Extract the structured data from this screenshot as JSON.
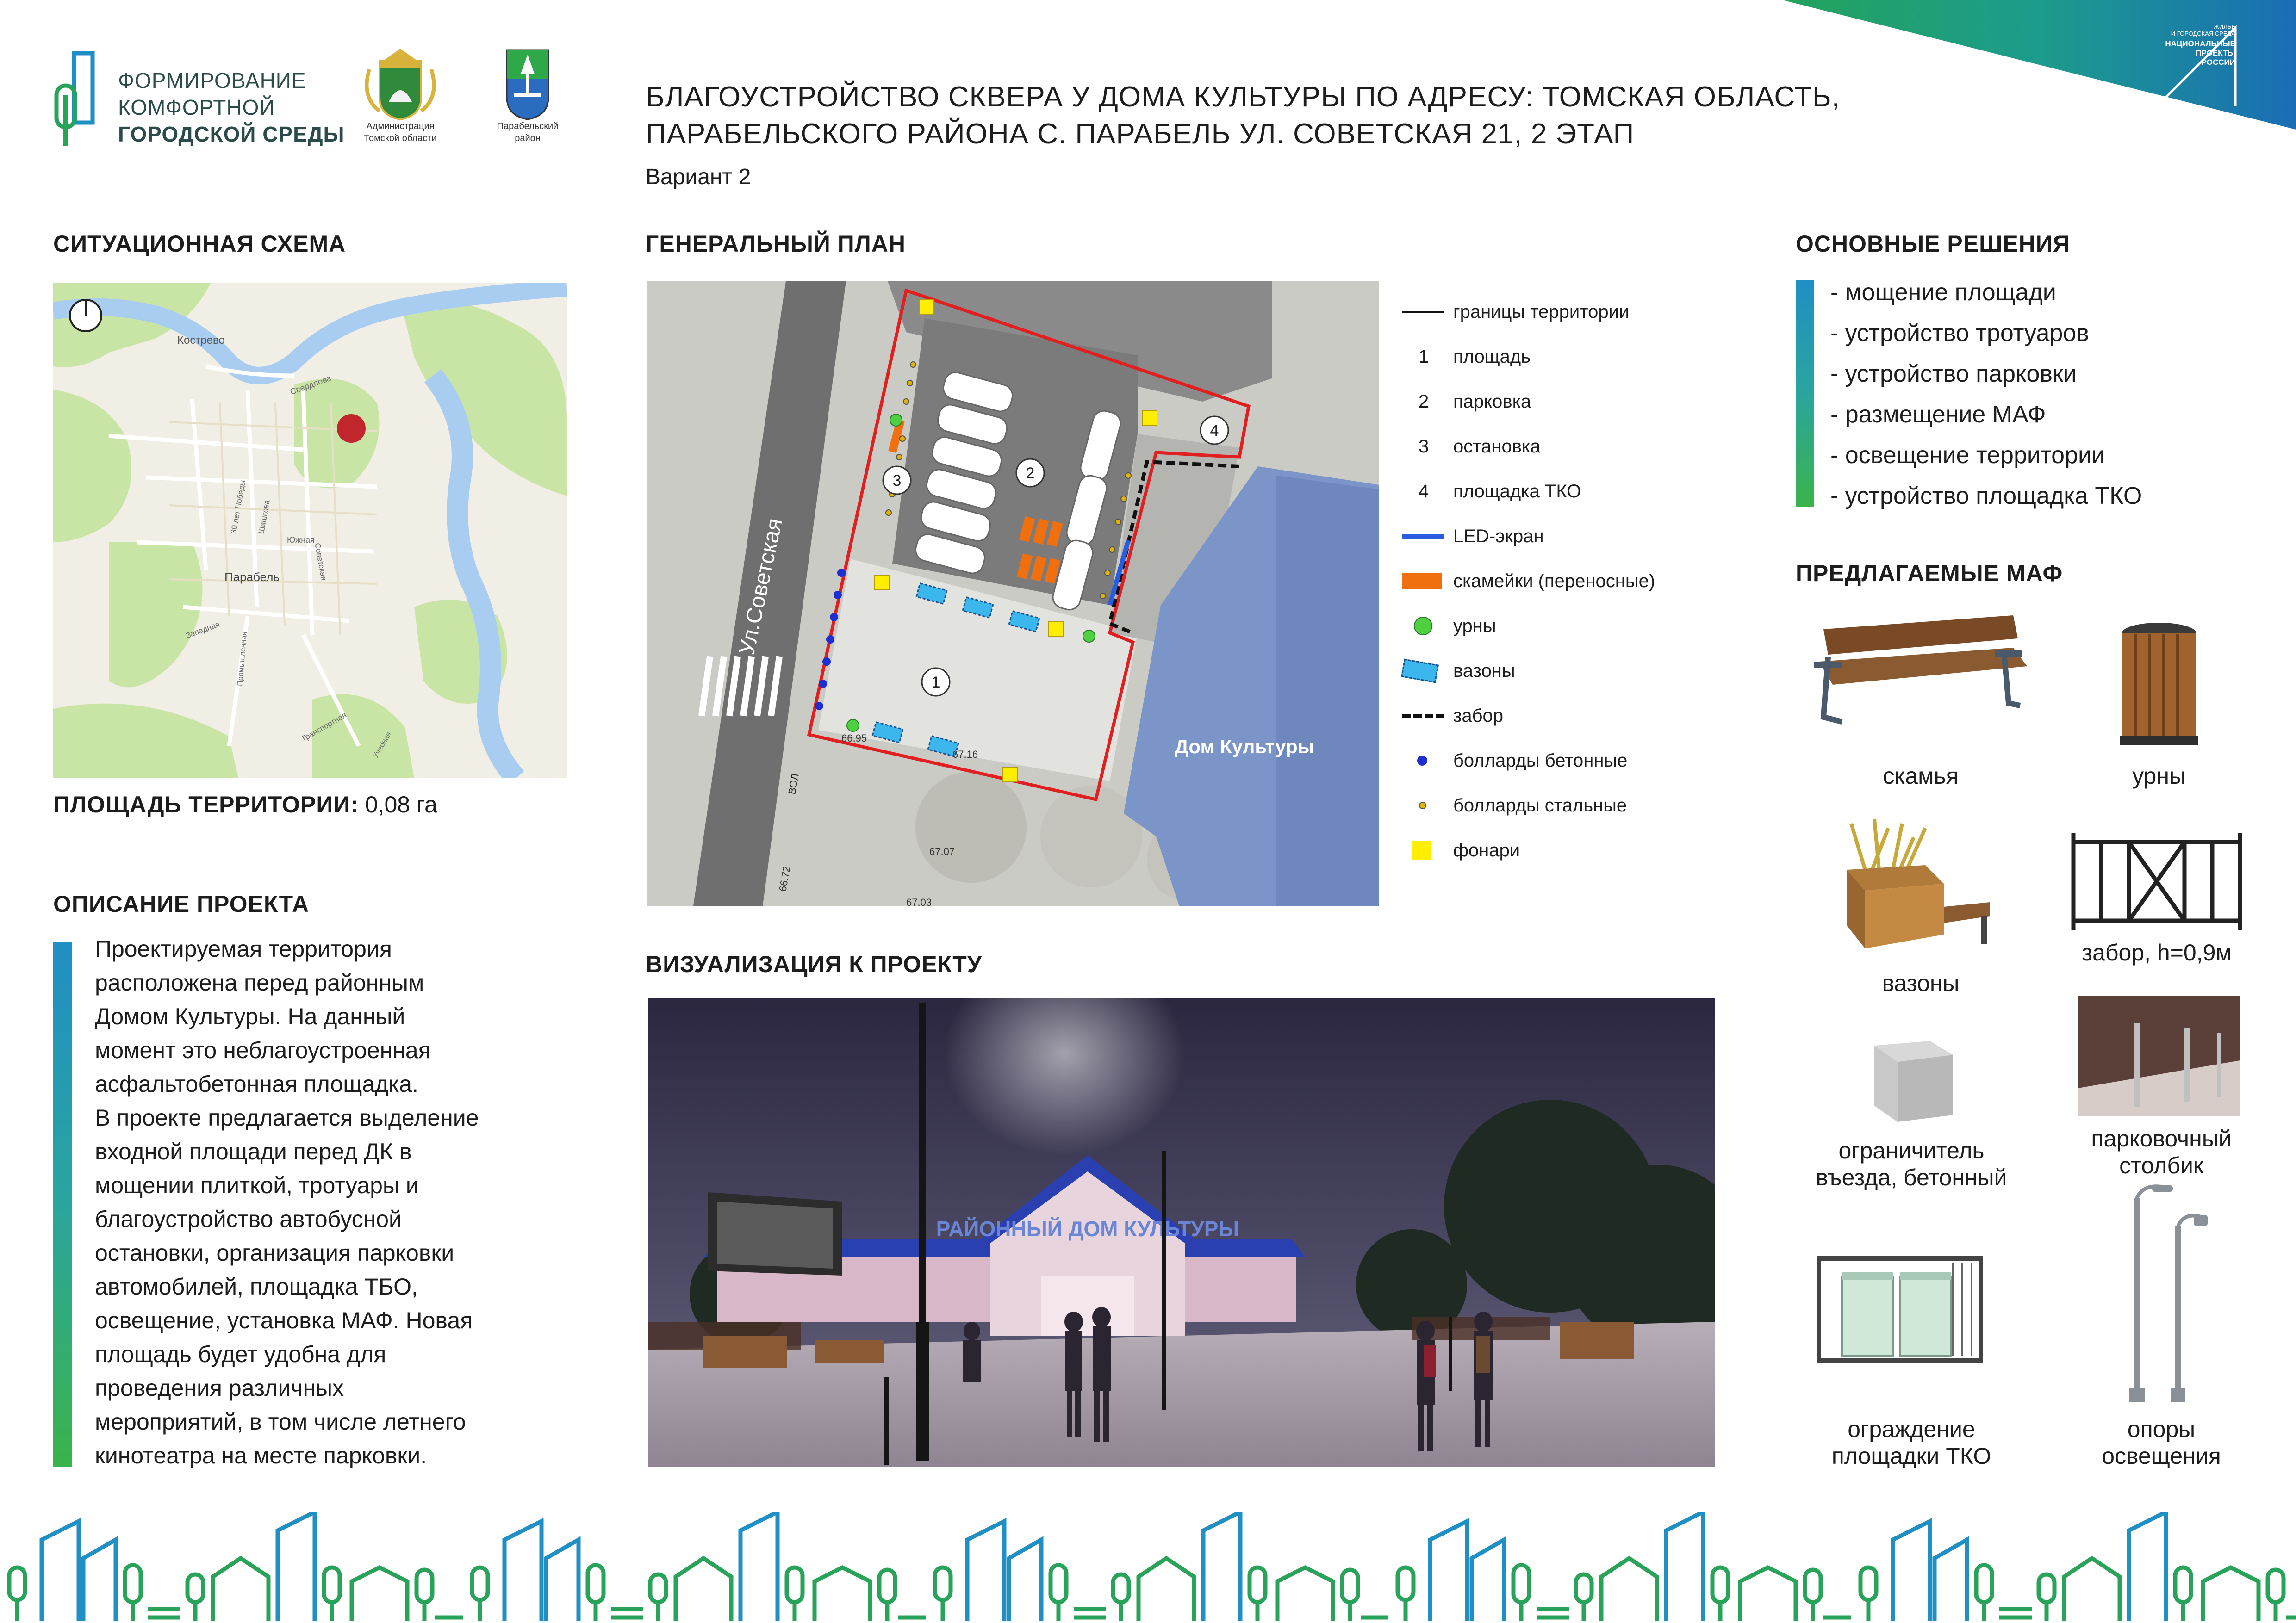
{
  "header": {
    "program_line1": "ФОРМИРОВАНИЕ",
    "program_line2": "КОМФОРТНОЙ",
    "program_line3": "ГОРОДСКОЙ СРЕДЫ",
    "emblem1_line1": "Администрация",
    "emblem1_line2": "Томской области",
    "emblem2_line1": "Парабельский",
    "emblem2_line2": "район",
    "corner_small1": "ЖИЛЬЕ",
    "corner_small2": "И ГОРОДСКАЯ СРЕДА",
    "corner_line1": "НАЦИОНАЛЬНЫЕ",
    "corner_line2": "ПРОЕКТЫ",
    "corner_line3": "РОССИИ",
    "title_line1": "БЛАГОУСТРОЙСТВО СКВЕРА У ДОМА КУЛЬТУРЫ ПО АДРЕСУ: ТОМСКАЯ ОБЛАСТЬ,",
    "title_line2": "ПАРАБЕЛЬСКОГО РАЙОНА С. ПАРАБЕЛЬ УЛ. СОВЕТСКАЯ 21, 2 ЭТАП",
    "variant": "Вариант 2"
  },
  "situation": {
    "heading": "СИТУАЦИОННАЯ СХЕМА",
    "labels": {
      "kostarevo": "Кострево",
      "sverdlova": "Свердлова",
      "pobedy": "30 лет Победы",
      "shishkova": "Шишкова",
      "yuzhnaya": "Южная",
      "sovetskaya": "Советская",
      "parabel": "Парабель",
      "zapadnaya": "Западная",
      "promyshlennaya": "Промышленная",
      "transportnaya": "Транспортная",
      "uchebnaya": "Учебная"
    },
    "area_label": "ПЛОЩАДЬ ТЕРРИТОРИИ:",
    "area_value": "0,08 га"
  },
  "description": {
    "heading": "ОПИСАНИЕ ПРОЕКТА",
    "lines": [
      "Проектируемая территория",
      "расположена перед районным",
      "Домом Культуры. На данный",
      "момент это неблагоустроенная",
      "асфальтобетонная площадка.",
      "В проекте предлагается выделение",
      "входной площади перед ДК в",
      "мощении плиткой, тротуары и",
      "благоустройство автобусной",
      "остановки, организация парковки",
      "автомобилей, площадка ТБО,",
      "освещение, установка МАФ. Новая",
      "площадь будет удобна для",
      "проведения различных",
      "мероприятий, в том числе летнего",
      "кинотеатра на месте парковки."
    ]
  },
  "plan": {
    "heading": "ГЕНЕРАЛЬНЫЙ ПЛАН",
    "street": "Ул.Советская",
    "building": "Дом Культуры",
    "num1": "1",
    "num2": "2",
    "num3": "3",
    "num4": "4",
    "elev1": "67.16",
    "elev2": "67.07",
    "elev3": "66.72",
    "elev4": "67.03",
    "elev5": "66.95",
    "vol": "ВОЛ",
    "legend": [
      {
        "sym": "line",
        "label": "границы территории"
      },
      {
        "sym": "1",
        "label": "площадь"
      },
      {
        "sym": "2",
        "label": "парковка"
      },
      {
        "sym": "3",
        "label": "остановка"
      },
      {
        "sym": "4",
        "label": "площадка ТКО"
      },
      {
        "sym": "led",
        "label": "LED-экран"
      },
      {
        "sym": "bench",
        "label": "скамейки (переносные)"
      },
      {
        "sym": "urn",
        "label": "урны"
      },
      {
        "sym": "vase",
        "label": "вазоны"
      },
      {
        "sym": "fence",
        "label": "забор"
      },
      {
        "sym": "bollard-big",
        "label": "болларды бетонные"
      },
      {
        "sym": "bollard-small",
        "label": "болларды стальные"
      },
      {
        "sym": "lamp",
        "label": "фонари"
      }
    ]
  },
  "visualization": {
    "heading": "ВИЗУАЛИЗАЦИЯ К ПРОЕКТУ",
    "facade_text": "РАЙОННЫЙ ДОМ КУЛЬТУРЫ"
  },
  "solutions": {
    "heading": "ОСНОВНЫЕ РЕШЕНИЯ",
    "items": [
      "- мощение площади",
      "- устройство тротуаров",
      "- устройство парковки",
      "- размещение МАФ",
      "- освещение территории",
      "- устройство площадка ТКО"
    ]
  },
  "maf": {
    "heading": "ПРЕДЛАГАЕМЫЕ МАФ",
    "bench": "скамья",
    "urn": "урны",
    "planter": "вазоны",
    "fence": "забор, h=0,9м",
    "limiter_1": "ограничитель",
    "limiter_2": "въезда, бетонный",
    "post_1": "парковочный",
    "post_2": "столбик",
    "tko_1": "ограждение",
    "tko_2": "площадки ТКО",
    "lights_1": "опоры",
    "lights_2": "освещения"
  },
  "colors": {
    "accent_green": "#27a35a",
    "accent_blue": "#1f8fc4",
    "boundary_red": "#e02020",
    "bench_orange": "#f07010",
    "led_blue": "#2a5ce0",
    "lamp_yellow": "#ffee00"
  }
}
